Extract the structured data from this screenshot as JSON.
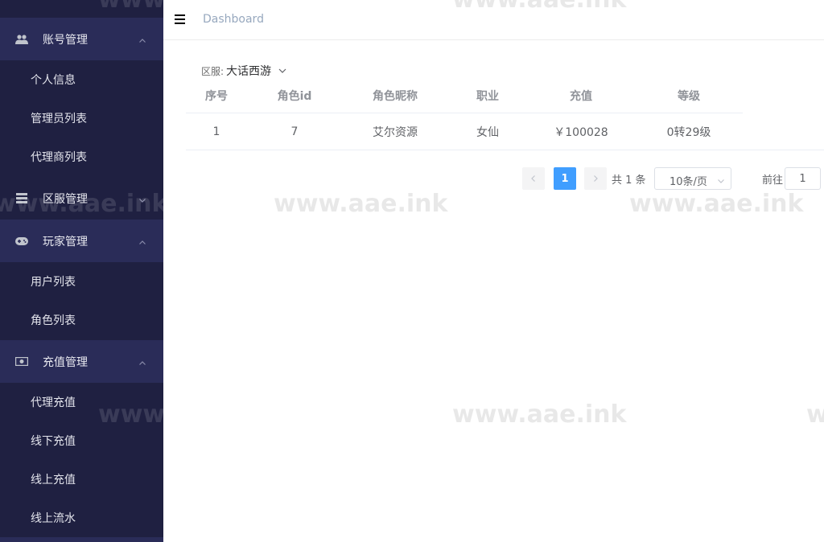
{
  "sidebar": {
    "groups": [
      {
        "label": "账号管理",
        "icon": "users-icon",
        "expanded": true
      },
      {
        "label": "区服管理",
        "icon": "server-icon",
        "expanded": false
      },
      {
        "label": "玩家管理",
        "icon": "gamepad-icon",
        "expanded": true
      },
      {
        "label": "充值管理",
        "icon": "money-icon",
        "expanded": true
      }
    ],
    "items": [
      {
        "label": "个人信息"
      },
      {
        "label": "管理员列表"
      },
      {
        "label": "代理商列表"
      },
      {
        "label": "用户列表"
      },
      {
        "label": "角色列表"
      },
      {
        "label": "代理充值"
      },
      {
        "label": "线下充值"
      },
      {
        "label": "线上充值"
      },
      {
        "label": "线上流水"
      }
    ]
  },
  "header": {
    "breadcrumb": "Dashboard",
    "menu_icon": "hamburger-icon"
  },
  "filter": {
    "label": "区服:",
    "value": "大话西游"
  },
  "table": {
    "columns": [
      "序号",
      "角色id",
      "角色昵称",
      "职业",
      "充值",
      "等级"
    ],
    "rows": [
      [
        "1",
        "7",
        "艾尔资源",
        "女仙",
        "￥100028",
        "0转29级"
      ]
    ]
  },
  "pagination": {
    "current_page": "1",
    "total_text": "共 1 条",
    "page_size": "10条/页",
    "jump_label": "前往",
    "jump_value": "1"
  },
  "watermark": "www.aae.ink",
  "colors": {
    "sidebar_bg": "#1f2041",
    "sidebar_group_bg": "#2a2c58",
    "accent": "#409eff",
    "breadcrumb": "#97a8be"
  }
}
